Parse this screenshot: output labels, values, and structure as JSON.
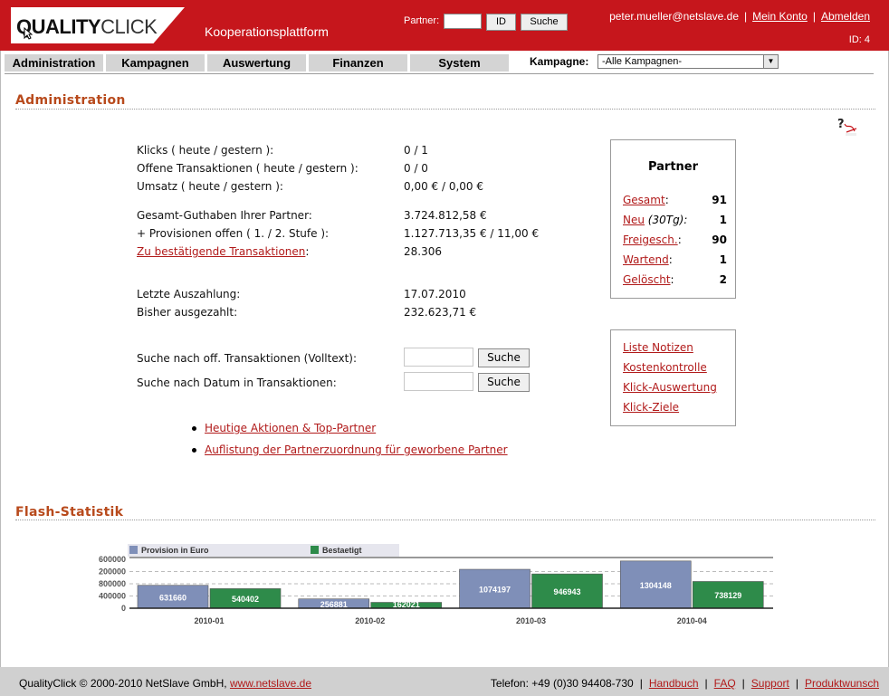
{
  "header": {
    "logo_bold": "QUALITY",
    "logo_light": "CLICK",
    "platform": "Kooperationsplattform",
    "partner_label": "Partner:",
    "partner_input_value": "",
    "id_button": "ID",
    "search_button": "Suche",
    "email": "peter.mueller@netslave.de",
    "my_account": "Mein Konto",
    "logout": "Abmelden",
    "sep": "|",
    "user_id": "ID: 4"
  },
  "nav": {
    "tabs": [
      "Administration",
      "Kampagnen",
      "Auswertung",
      "Finanzen",
      "System"
    ],
    "kampagne_label": "Kampagne:",
    "kampagne_selected": "-Alle Kampagnen-"
  },
  "admin": {
    "title": "Administration",
    "help_icon": "help-pdf-icon",
    "stats": [
      {
        "label": "Klicks ( heute / gestern ):",
        "value": "0 / 1"
      },
      {
        "label": "Offene Transaktionen ( heute / gestern ):",
        "value": "0 / 0"
      },
      {
        "label": "Umsatz ( heute / gestern ):",
        "value": "0,00 € / 0,00 €"
      },
      {
        "label": "Gesamt-Guthaben Ihrer Partner:",
        "value": "3.724.812,58 €"
      },
      {
        "label": "+ Provisionen offen ( 1. / 2. Stufe ):",
        "value": "1.127.713,35 € / 11,00 €"
      },
      {
        "label": "Zu bestätigende Transaktionen",
        "label_suffix": ":",
        "value": "28.306"
      },
      {
        "label": "Letzte Auszahlung:",
        "value": "17.07.2010"
      },
      {
        "label": "Bisher ausgezahlt:",
        "value": "232.623,71 €"
      }
    ],
    "search_fulltext_label": "Suche nach off. Transaktionen (Volltext):",
    "search_date_label": "Suche nach Datum in Transaktionen:",
    "search_button": "Suche",
    "bullet_links": [
      "Heutige Aktionen & Top-Partner",
      "Auflistung der Partnerzuordnung für geworbene Partner"
    ]
  },
  "partner_box": {
    "title": "Partner",
    "rows": [
      {
        "label": "Gesamt",
        "suffix": ":",
        "value": "91"
      },
      {
        "label": "Neu",
        "suffix": " (30Tg):",
        "value": "1"
      },
      {
        "label": "Freigesch.",
        "suffix": ":",
        "value": "90"
      },
      {
        "label": "Wartend",
        "suffix": ":",
        "value": "1"
      },
      {
        "label": "Gelöscht",
        "suffix": ":",
        "value": "2"
      }
    ]
  },
  "links_box": {
    "links": [
      "Liste Notizen",
      "Kostenkontrolle",
      "Klick-Auswertung",
      "Klick-Ziele"
    ]
  },
  "flash": {
    "title": "Flash-Statistik"
  },
  "chart_data": {
    "type": "bar",
    "categories": [
      "2010-01",
      "2010-02",
      "2010-03",
      "2010-04"
    ],
    "series": [
      {
        "name": "Provision in Euro",
        "values": [
          631660,
          256881,
          1074197,
          1304148
        ],
        "color": "#7f8fb8"
      },
      {
        "name": "Bestaetigt",
        "values": [
          540402,
          162021,
          946943,
          738129
        ],
        "color": "#2e8b4a"
      }
    ],
    "y_tick_labels": [
      "600000",
      "200000",
      "800000",
      "400000",
      "0"
    ],
    "ylim": [
      0,
      1400000
    ],
    "legend": "top-left",
    "grid": true
  },
  "footer": {
    "copyright": "QualityClick © 2000-2010 NetSlave GmbH, ",
    "site_link": "www.netslave.de",
    "phone": "Telefon: +49 (0)30 94408-730",
    "links": [
      "Handbuch",
      "FAQ",
      "Support",
      "Produktwunsch"
    ],
    "sep": "|"
  },
  "colors": {
    "brand_red": "#c6161c",
    "link_red": "#b11a1a",
    "section_title": "#b84a1c"
  }
}
